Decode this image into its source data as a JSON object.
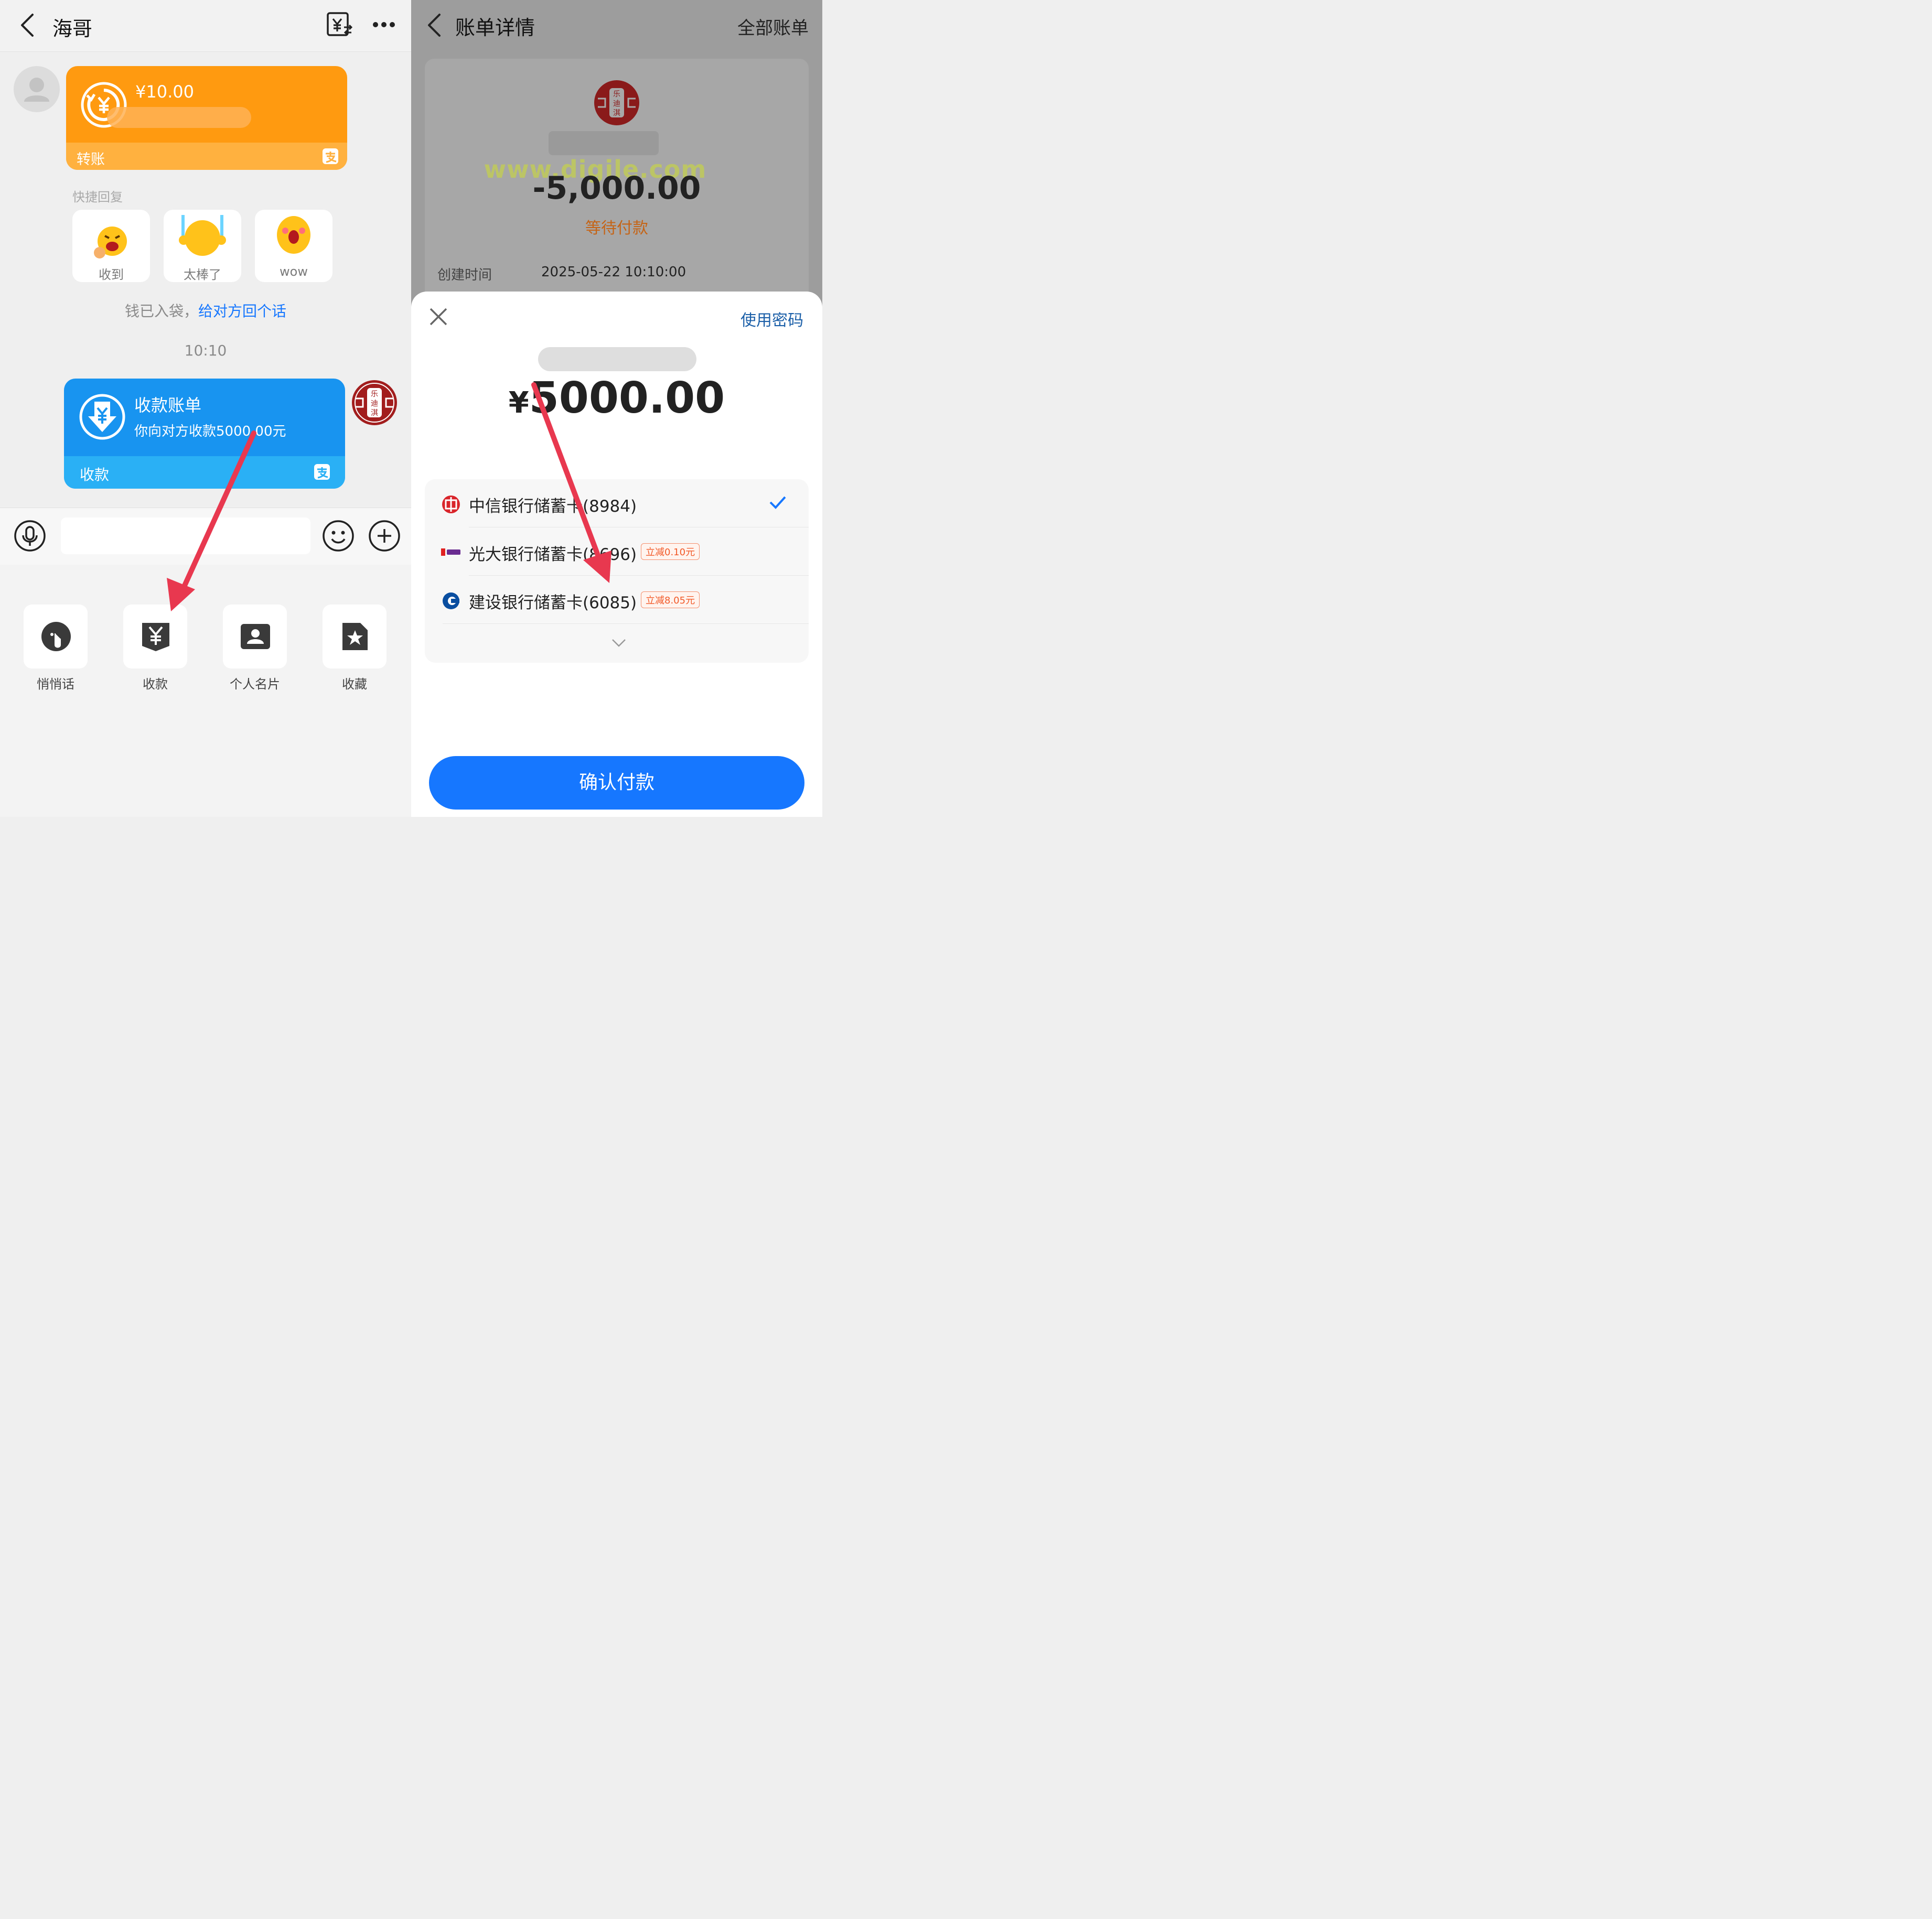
{
  "left": {
    "header": {
      "back_icon": "chevron-left",
      "title": "海哥",
      "bill_icon": "yuan-bill-icon",
      "more_icon": "more-dots"
    },
    "transfer_bubble": {
      "amount": "¥10.00",
      "footer_label": "转账",
      "colors": {
        "body": "#ff9a10",
        "footer": "#ffb13f"
      }
    },
    "quick_reply": {
      "title": "快捷回复",
      "items": [
        {
          "label": "收到"
        },
        {
          "label": "太棒了"
        },
        {
          "label": "wow"
        }
      ]
    },
    "notice": {
      "prefix": "钱已入袋，",
      "link": "给对方回个话"
    },
    "timestamp": "10:10",
    "collect_bubble": {
      "title": "收款账单",
      "subtitle": "你向对方收款5000.00元",
      "footer_label": "收款",
      "colors": {
        "body": "#1894f0",
        "footer": "#2ab0f5"
      }
    },
    "avatar_seal": {
      "chars": [
        "乐",
        "迪",
        "淇"
      ],
      "color": "#9c1c1c"
    },
    "input_bar": {
      "voice_icon": "microphone",
      "emoji_icon": "smiley",
      "add_icon": "plus-circle"
    },
    "tray": {
      "items": [
        {
          "label": "悄悄话",
          "icon": "whisper-icon"
        },
        {
          "label": "收款",
          "icon": "collect-yuan-icon"
        },
        {
          "label": "个人名片",
          "icon": "contact-card-icon"
        },
        {
          "label": "收藏",
          "icon": "favorite-star-icon"
        }
      ]
    }
  },
  "right": {
    "header": {
      "back_icon": "chevron-left",
      "title": "账单详情",
      "all_bills": "全部账单"
    },
    "bill": {
      "amount": "-5,000.00",
      "status": "等待付款",
      "created_label": "创建时间",
      "created_value": "2025-05-22 10:10:00",
      "status_color": "#c56416"
    },
    "watermark": "www.digile.com",
    "sheet": {
      "close_icon": "close-x",
      "use_password": "使用密码",
      "currency": "¥",
      "amount": "5000.00",
      "cards": [
        {
          "label": "中信银行储蓄卡(8984)",
          "bank_icon": "citic-bank-icon",
          "selected": true,
          "promo": ""
        },
        {
          "label": "光大银行储蓄卡(8696)",
          "bank_icon": "ceb-bank-icon",
          "selected": false,
          "promo": "立减0.10元"
        },
        {
          "label": "建设银行储蓄卡(6085)",
          "bank_icon": "ccb-bank-icon",
          "selected": false,
          "promo": "立减8.05元"
        }
      ],
      "expand_icon": "chevron-down",
      "confirm": "确认付款"
    }
  },
  "annotation_color": "#e8384f"
}
